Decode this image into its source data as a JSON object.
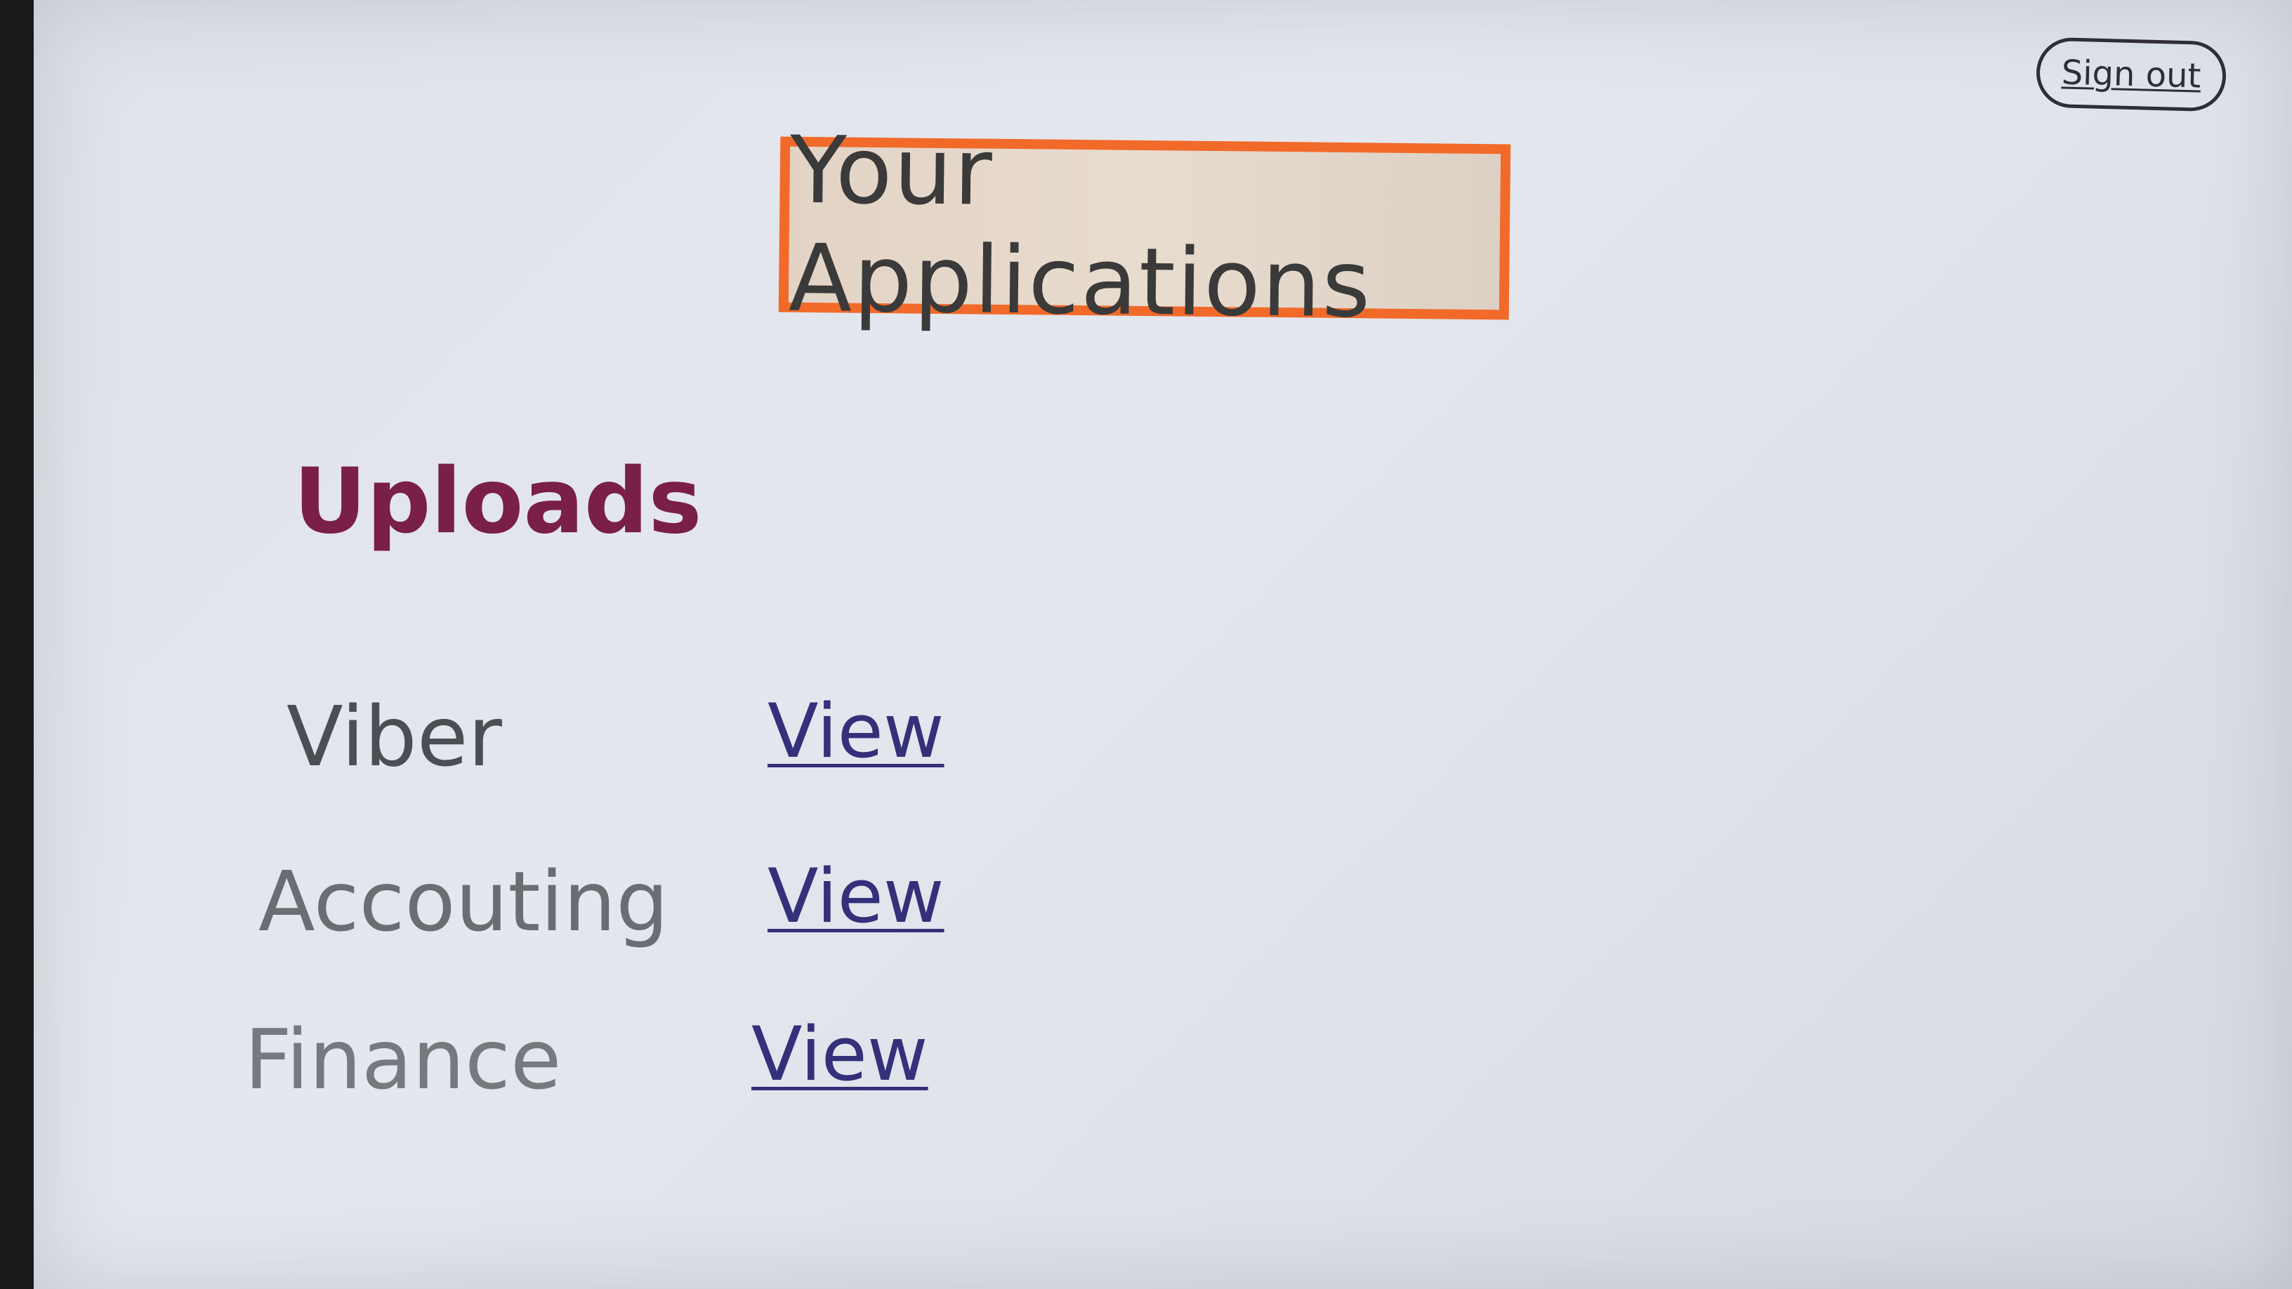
{
  "header": {
    "sign_out_label": "Sign out",
    "title": "Your Applications"
  },
  "main": {
    "section_title": "Uploads",
    "applications": [
      {
        "name": "Viber",
        "action_label": "View"
      },
      {
        "name": "Accouting",
        "action_label": "View"
      },
      {
        "name": "Finance",
        "action_label": "View"
      }
    ]
  },
  "colors": {
    "title_border": "#f26a2a",
    "section_title": "#7a1f45",
    "link": "#34307a"
  }
}
